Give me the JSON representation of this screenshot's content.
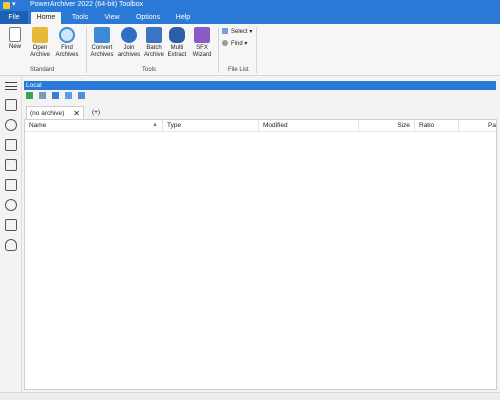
{
  "window": {
    "title": "PowerArchiver 2022 (64-bit) Toolbox"
  },
  "ribbon_tabs": [
    {
      "label": "File"
    },
    {
      "label": "Home"
    },
    {
      "label": "Tools"
    },
    {
      "label": "View"
    },
    {
      "label": "Options"
    },
    {
      "label": "Help"
    }
  ],
  "ribbon": {
    "standard": {
      "new": "New",
      "open": "Open Archive",
      "find": "Find Archives",
      "group": "Standard"
    },
    "tools": {
      "convert": "Convert Archives",
      "join": "Join archives",
      "batch": "Batch Archive",
      "multi": "Multi Extract",
      "sfx": "SFX Wizard",
      "group": "Tools"
    },
    "filelist": {
      "select": "Select",
      "find": "Find",
      "group": "File List"
    }
  },
  "local_bar": {
    "label": "Local"
  },
  "archive_tabs": {
    "current": "(no archive)",
    "add": "(+)"
  },
  "columns": [
    "Name",
    "Type",
    "Modified",
    "Size",
    "Ratio",
    "Pa"
  ],
  "colors": {
    "accent": "#2b79d7"
  },
  "icons": [
    "hamburger-menu-icon",
    "archive-icon",
    "history-icon",
    "drive-icon",
    "folder-icon",
    "list-icon",
    "settings-icon",
    "lock-icon",
    "cloud-icon"
  ]
}
